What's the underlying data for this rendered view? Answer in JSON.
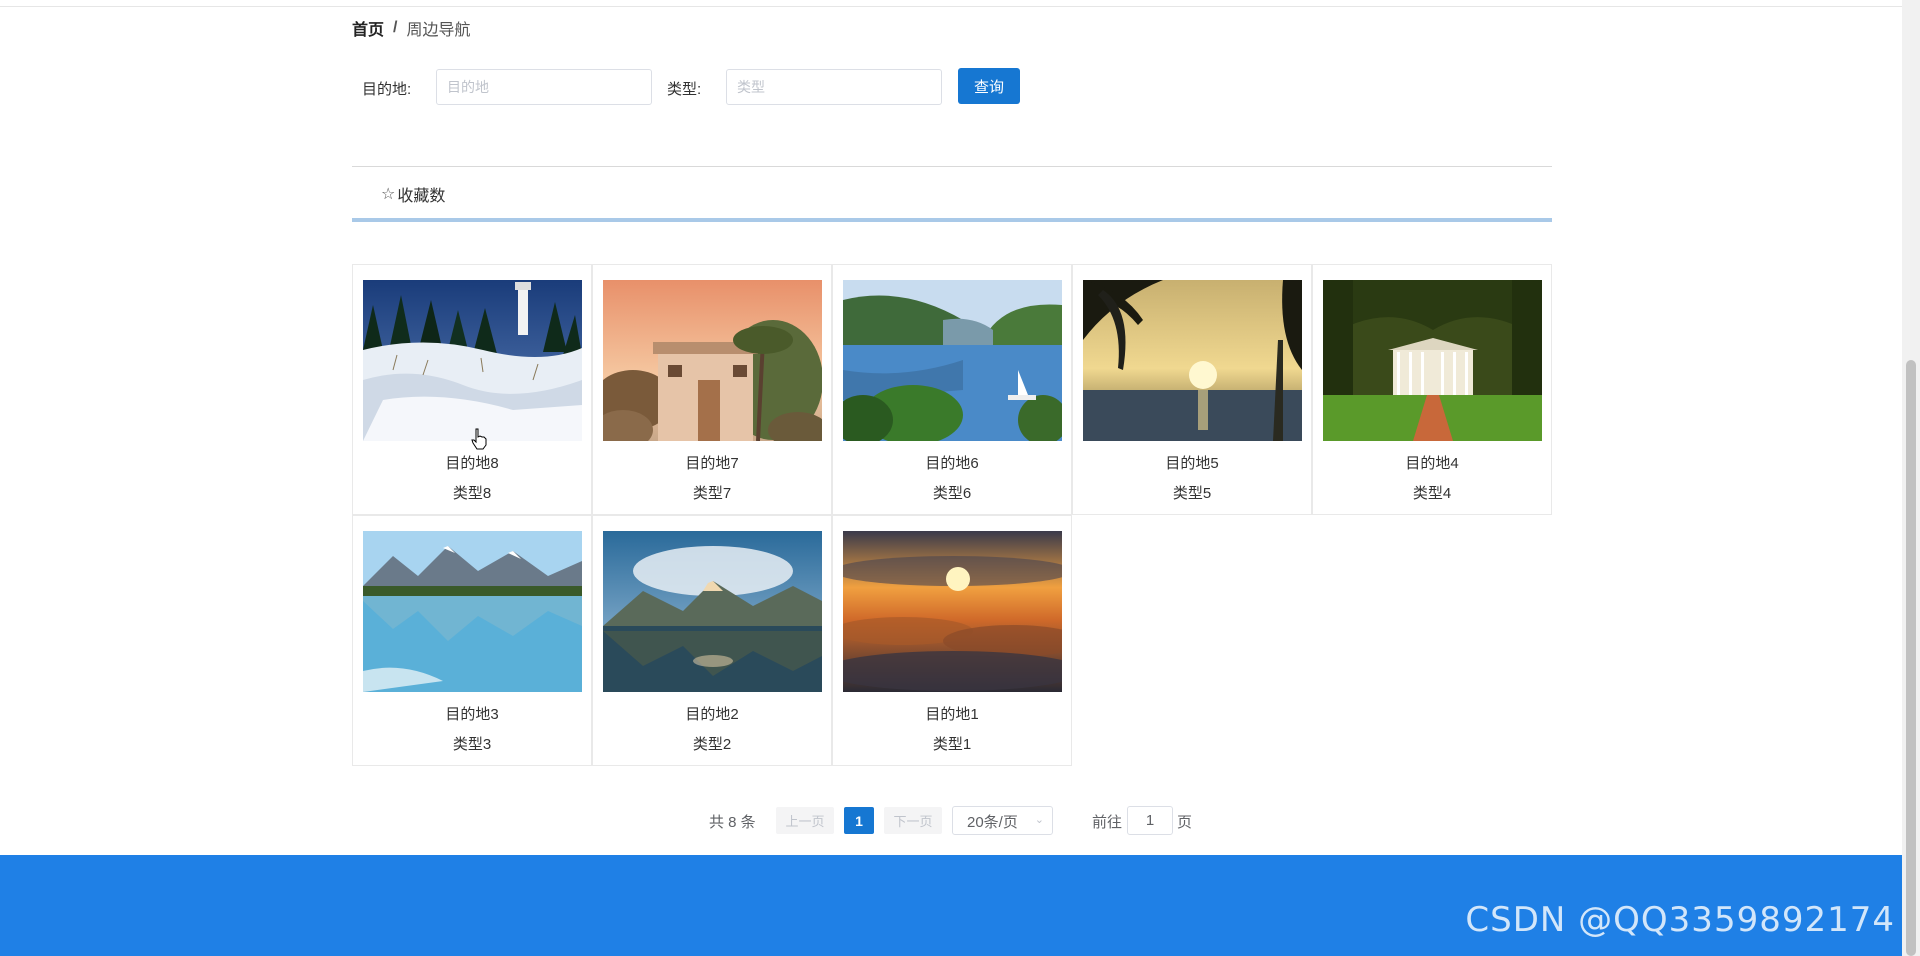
{
  "breadcrumb": {
    "home": "首页",
    "separator": "/",
    "current": "周边导航"
  },
  "search": {
    "destination_label": "目的地:",
    "destination_placeholder": "目的地",
    "type_label": "类型:",
    "type_placeholder": "类型",
    "query_button": "查询"
  },
  "tabs": {
    "favorites_label": "收藏数",
    "favorites_icon": "star-outline-icon"
  },
  "cards": [
    {
      "name": "目的地8",
      "type": "类型8",
      "scene": "snowy-lighthouse"
    },
    {
      "name": "目的地7",
      "type": "类型7",
      "scene": "adobe-house-sunset"
    },
    {
      "name": "目的地6",
      "type": "类型6",
      "scene": "river-valley-sailboat"
    },
    {
      "name": "目的地5",
      "type": "类型5",
      "scene": "palm-sunset-sea"
    },
    {
      "name": "目的地4",
      "type": "类型4",
      "scene": "oak-alley-mansion"
    },
    {
      "name": "目的地3",
      "type": "类型3",
      "scene": "mountain-lake-reflection"
    },
    {
      "name": "目的地2",
      "type": "类型2",
      "scene": "misty-mountain-lake"
    },
    {
      "name": "目的地1",
      "type": "类型1",
      "scene": "sunset-above-clouds"
    }
  ],
  "pagination": {
    "total_text": "共 8 条",
    "prev_label": "上一页",
    "current_page": "1",
    "next_label": "下一页",
    "page_size": "20条/页",
    "goto_label": "前往",
    "goto_value": "1",
    "page_unit": "页"
  },
  "watermark": "CSDN @QQ3359892174",
  "colors": {
    "primary": "#1677d2",
    "footer": "#1f80e6",
    "tab_underline": "#a9c9e8"
  }
}
